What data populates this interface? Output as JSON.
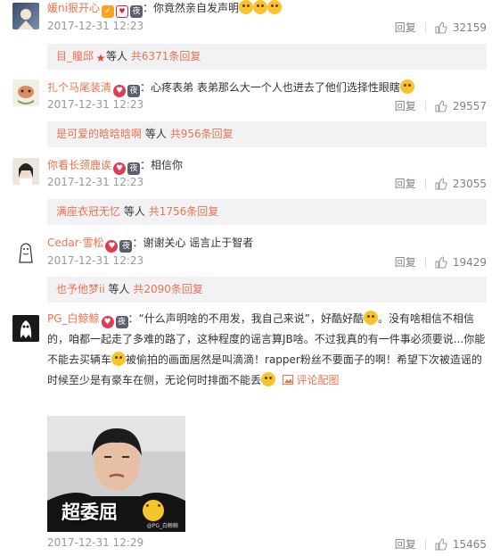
{
  "actions": {
    "reply": "回复"
  },
  "comments": [
    {
      "user": "媛ni狠开心",
      "text": "：你竟然亲自发声明",
      "time": "2017-12-31 12:23",
      "likes": "32159",
      "sub": {
        "user": "目_瞳邱",
        "mid": "等人",
        "count": "共6371条回复"
      }
    },
    {
      "user": "扎个马尾装清",
      "text": "：心疼表弟 表弟那么大一个人也进去了他们选择性眼瞎",
      "time": "2017-12-31 12:23",
      "likes": "29557",
      "sub": {
        "user": "是可爱的晗晗晗啊",
        "mid": "等人",
        "count": "共956条回复"
      }
    },
    {
      "user": "你看长颈鹿诶",
      "text": "：相信你",
      "time": "2017-12-31 12:23",
      "likes": "23055",
      "sub": {
        "user": "满座衣冠无忆",
        "mid": "等人",
        "count": "共1756条回复"
      }
    },
    {
      "user": "Cedar·雪松",
      "text": "：谢谢关心 谣言止于智者",
      "time": "2017-12-31 12:23",
      "likes": "19429",
      "sub": {
        "user": "也予他梦ii",
        "mid": "等人",
        "count": "共2090条回复"
      }
    },
    {
      "user": "PG_白鲸鲸",
      "text_l1": "：“什么声明啥的不用发，我自己来说”，好酷好酷",
      "text_l1b": "。没有啥相信不相信",
      "text_l2": "的，咱都一起走了多难的路了，这种程度的谣言算JB啥。不过我真的有一件事必须要说...你能",
      "text_l3a": "不能去买辆车",
      "text_l3b": "被偷拍的画面居然是叫滴滴！rapper粉丝不要面子的啊！希望下次被造谣的",
      "text_l4": "时候至少是有豪车在侧，无论何时排面不能丢",
      "pic_link": "评论配图",
      "pic_caption": "超委屈",
      "pic_watermark": "@PG_白鲸鲸",
      "time": "2017-12-31 12:29",
      "likes": "15465"
    }
  ]
}
